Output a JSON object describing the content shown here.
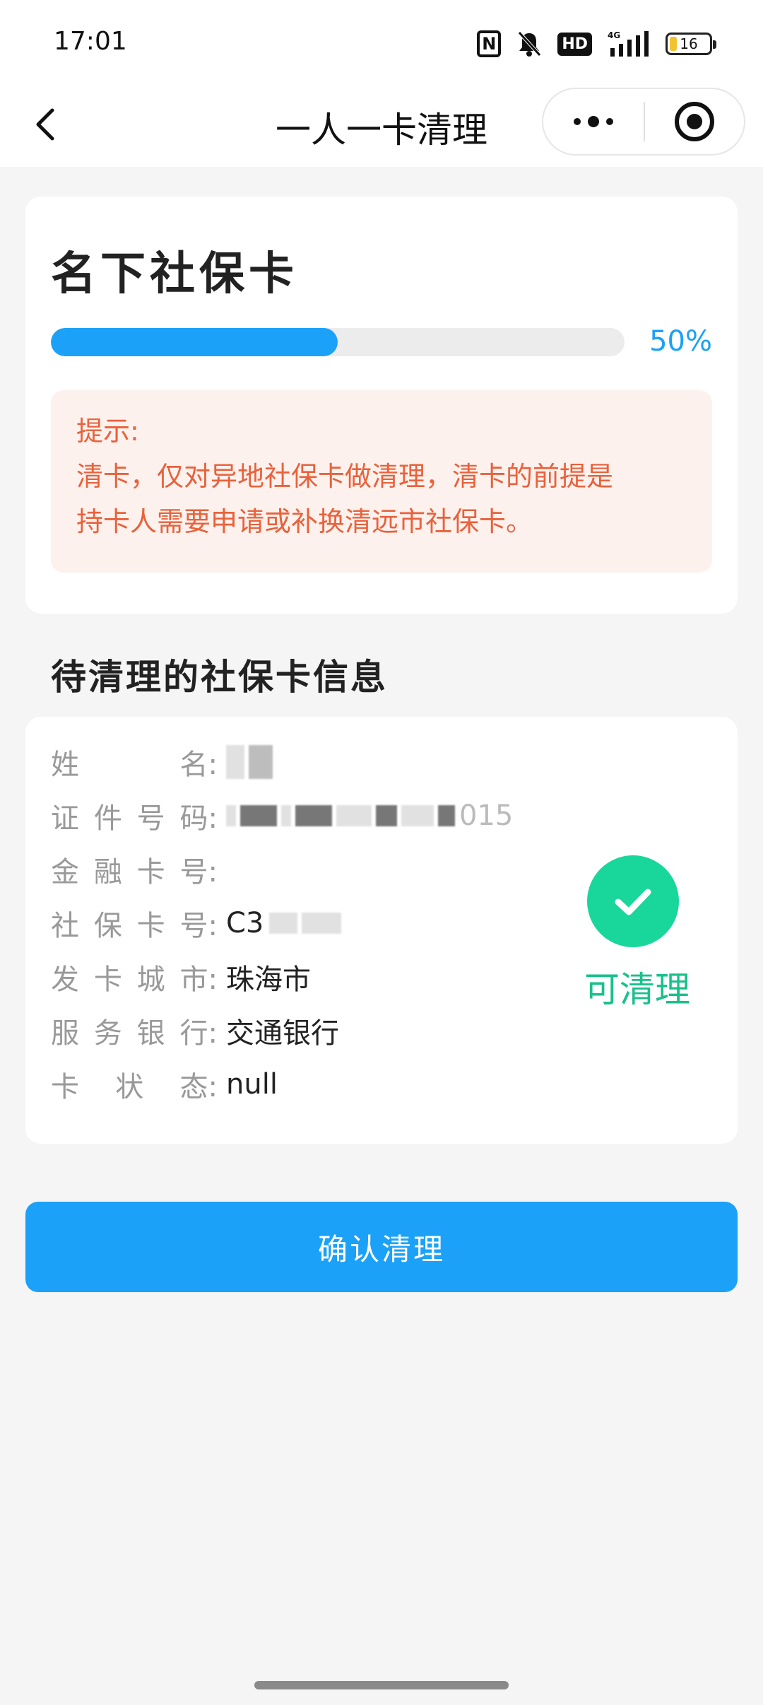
{
  "status_bar": {
    "time": "17:01",
    "icons": [
      "nfc-icon",
      "bell-off-icon",
      "hd-icon",
      "signal-4g-icon",
      "battery-icon"
    ],
    "hd_label": "HD",
    "battery_level": "16"
  },
  "nav": {
    "title": "一人一卡清理",
    "back_icon": "chevron-left-icon",
    "more_icon": "more-dots-icon",
    "close_icon": "target-close-icon"
  },
  "summary_card": {
    "title": "名下社保卡",
    "progress_percent": 50,
    "progress_text": "50%",
    "tip_lines": [
      "提示:",
      "清卡，仅对异地社保卡做清理，清卡的前提是",
      "持卡人需要申请或补换清远市社保卡。"
    ]
  },
  "section": {
    "title": "待清理的社保卡信息"
  },
  "card_info": {
    "fields": [
      {
        "label": [
          "姓",
          "名"
        ],
        "value": ""
      },
      {
        "label": [
          "证",
          "件",
          "号",
          "码"
        ],
        "value": "015"
      },
      {
        "label": [
          "金",
          "融",
          "卡",
          "号"
        ],
        "value": ""
      },
      {
        "label": [
          "社",
          "保",
          "卡",
          "号"
        ],
        "value": "C3"
      },
      {
        "label": [
          "发",
          "卡",
          "城",
          "市"
        ],
        "value": "珠海市"
      },
      {
        "label": [
          "服",
          "务",
          "银",
          "行"
        ],
        "value": "交通银行"
      },
      {
        "label": [
          "卡",
          "状",
          "态"
        ],
        "value": "null"
      }
    ],
    "colon": ":",
    "status_label": "可清理",
    "status_icon": "check-circle-icon"
  },
  "actions": {
    "confirm_label": "确认清理"
  },
  "colors": {
    "primary": "#1ba1f8",
    "success": "#19d69a",
    "tip_text": "#e8623b",
    "tip_bg": "#fdf1ee"
  }
}
